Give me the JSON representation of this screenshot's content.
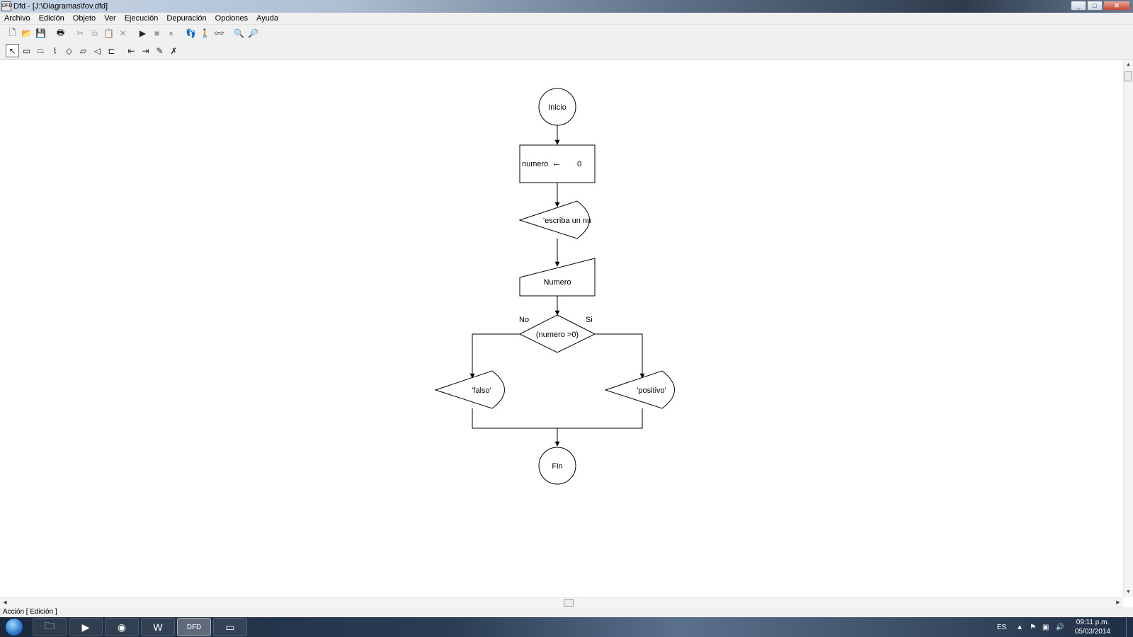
{
  "window": {
    "title": "Dfd - [J:\\Diagramas\\fov.dfd]",
    "minimize": "_",
    "maximize": "□",
    "close": "✕"
  },
  "menu": [
    "Archivo",
    "Edición",
    "Objeto",
    "Ver",
    "Ejecución",
    "Depuración",
    "Opciones",
    "Ayuda"
  ],
  "toolbar1": [
    {
      "name": "new-file-icon",
      "glyph": "🗋",
      "enabled": true
    },
    {
      "name": "open-folder-icon",
      "glyph": "📂",
      "enabled": true
    },
    {
      "name": "save-icon",
      "glyph": "💾",
      "enabled": true
    },
    {
      "name": "sep"
    },
    {
      "name": "print-icon",
      "glyph": "🖶",
      "enabled": true
    },
    {
      "name": "sep"
    },
    {
      "name": "cut-icon",
      "glyph": "✂",
      "enabled": false
    },
    {
      "name": "copy-icon",
      "glyph": "⧉",
      "enabled": false
    },
    {
      "name": "paste-icon",
      "glyph": "📋",
      "enabled": false
    },
    {
      "name": "delete-icon",
      "glyph": "✕",
      "enabled": false
    },
    {
      "name": "sep"
    },
    {
      "name": "run-icon",
      "glyph": "▶",
      "enabled": true
    },
    {
      "name": "stop-icon",
      "glyph": "■",
      "enabled": false
    },
    {
      "name": "pause-icon",
      "glyph": "⏸",
      "enabled": false
    },
    {
      "name": "sep"
    },
    {
      "name": "step-icon",
      "glyph": "👣",
      "enabled": true
    },
    {
      "name": "walk-icon",
      "glyph": "🚶",
      "enabled": false
    },
    {
      "name": "watch-icon",
      "glyph": "👓",
      "enabled": true
    },
    {
      "name": "sep"
    },
    {
      "name": "zoom-out-icon",
      "glyph": "🔍",
      "enabled": true
    },
    {
      "name": "zoom-in-icon",
      "glyph": "🔎",
      "enabled": true
    }
  ],
  "toolbar2": [
    {
      "name": "select-pointer-icon",
      "glyph": "↖",
      "selected": true
    },
    {
      "name": "assignment-shape-icon",
      "glyph": "▭"
    },
    {
      "name": "read-shape-icon",
      "glyph": "⏢"
    },
    {
      "name": "cycle-shape-icon",
      "glyph": "⌇"
    },
    {
      "name": "decision-shape-icon",
      "glyph": "◇"
    },
    {
      "name": "input-shape-icon",
      "glyph": "⏥"
    },
    {
      "name": "output-shape-icon",
      "glyph": "◁"
    },
    {
      "name": "subprogram-shape-icon",
      "glyph": "⊏"
    },
    {
      "name": "sep"
    },
    {
      "name": "insert-before-icon",
      "glyph": "⇤"
    },
    {
      "name": "insert-after-icon",
      "glyph": "⇥"
    },
    {
      "name": "edit-object-icon",
      "glyph": "✎"
    },
    {
      "name": "delete-object-icon",
      "glyph": "✗"
    }
  ],
  "flowchart": {
    "start_label": "Inicio",
    "assign_var": "numero",
    "assign_arrow": "←",
    "assign_value": "0",
    "output1_text": "'escriba un nu",
    "input_text": "Numero",
    "decision_text": "(numero >0)",
    "no_label": "No",
    "yes_label": "Si",
    "output_false_text": "'falso'",
    "output_true_text": "'positivo'",
    "end_label": "Fin"
  },
  "status": {
    "text": "Acción [ Edición ]"
  },
  "taskbar": {
    "apps": [
      {
        "name": "explorer-icon",
        "glyph": "🗀",
        "active": false
      },
      {
        "name": "media-player-icon",
        "glyph": "▶",
        "active": false
      },
      {
        "name": "chrome-icon",
        "glyph": "◉",
        "active": false
      },
      {
        "name": "word-icon",
        "glyph": "W",
        "active": false
      },
      {
        "name": "dfd-icon",
        "glyph": "DFD",
        "active": true
      },
      {
        "name": "window-icon",
        "glyph": "▭",
        "active": false
      }
    ],
    "language": "ES",
    "time": "09:11 p.m.",
    "date": "05/03/2014"
  }
}
